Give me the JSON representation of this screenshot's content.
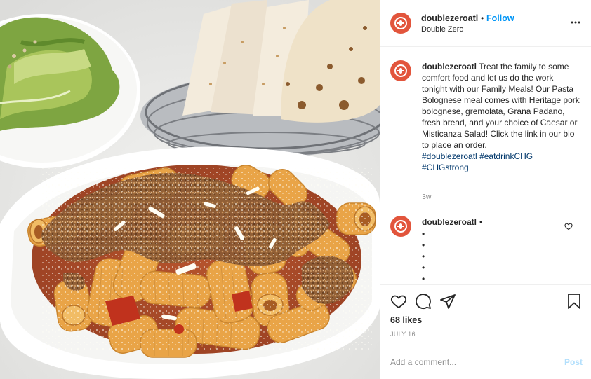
{
  "header": {
    "username": "doublezeroatl",
    "separator": "•",
    "follow_label": "Follow",
    "location": "Double Zero",
    "more_icon": "more-horizontal-icon"
  },
  "caption": {
    "username": "doublezeroatl",
    "text": "Treat the family to some comfort food and let us do the work tonight with our Family Meals! Our Pasta Bolognese meal comes with Heritage pork bolognese, gremolata, Grana Padano, fresh bread, and your choice of Caesar or Misticanza Salad! Click the link in our bio to place an order.",
    "hashtags": [
      "#doublezeroatl",
      "#eatdrinkCHG",
      "#CHGstrong"
    ],
    "time": "3w"
  },
  "comment": {
    "username": "doublezeroatl",
    "separator": "•",
    "lines": [
      "•",
      "•",
      "•",
      "•",
      "•"
    ]
  },
  "actions": {
    "icons": [
      "heart-icon",
      "comment-icon",
      "share-icon",
      "bookmark-icon"
    ],
    "likes": "68 likes",
    "date": "JULY 16"
  },
  "composer": {
    "placeholder": "Add a comment...",
    "post_label": "Post"
  },
  "colors": {
    "brand_avatar": "#e2553c",
    "follow_blue": "#0095f6",
    "hashtag": "#00376b",
    "muted": "#8e8e8e",
    "post_disabled": "#b2dffc"
  }
}
